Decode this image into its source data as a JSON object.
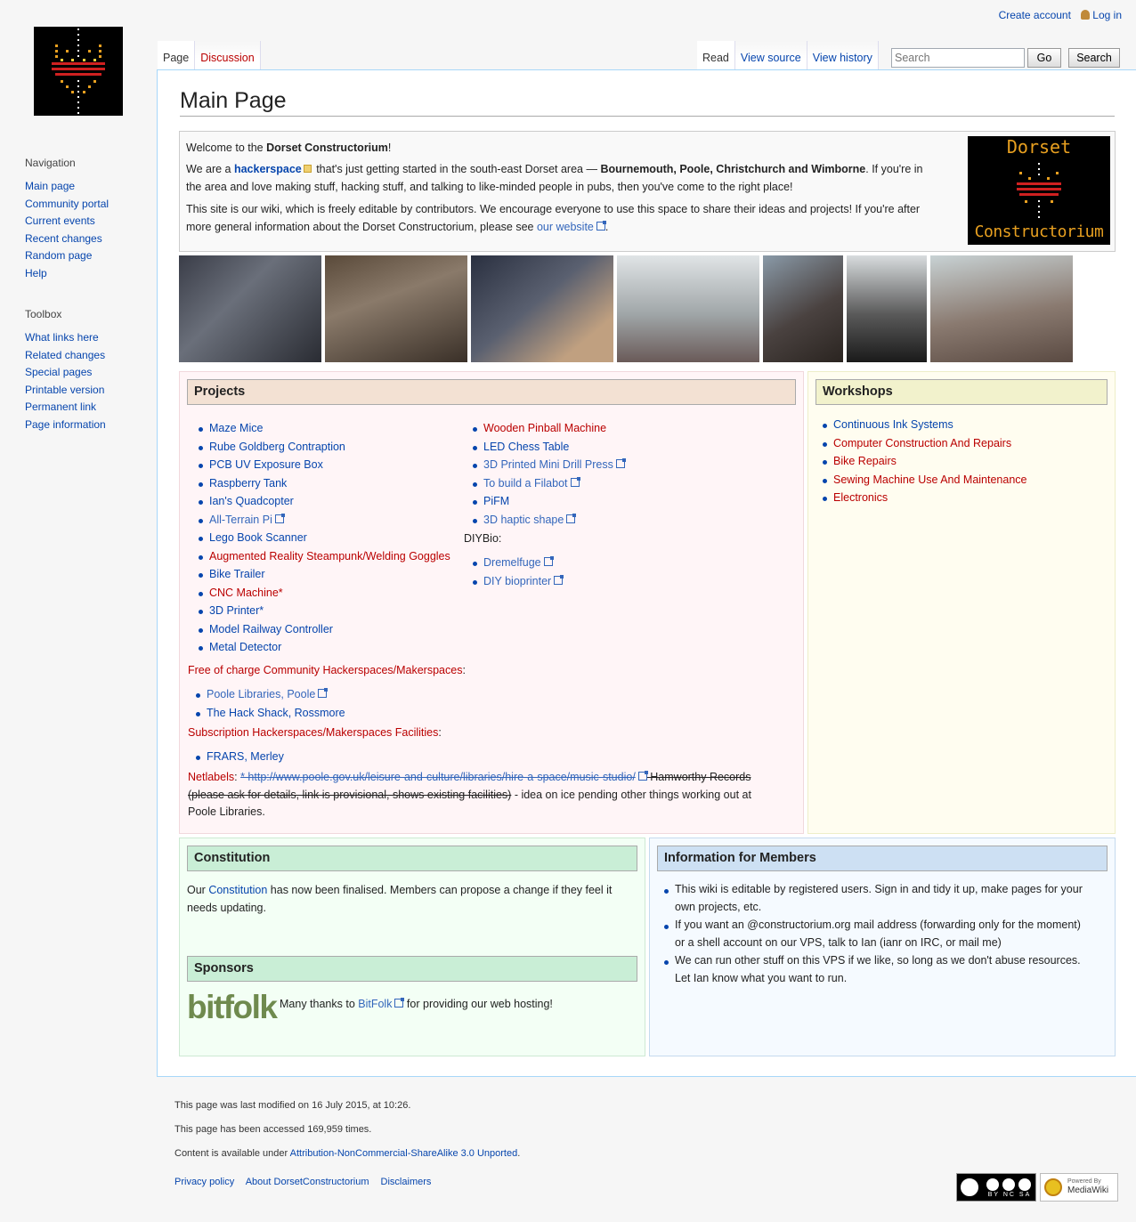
{
  "personal": {
    "create_account": "Create account",
    "log_in": "Log in"
  },
  "tabs": {
    "page": "Page",
    "discussion": "Discussion",
    "read": "Read",
    "view_source": "View source",
    "view_history": "View history"
  },
  "search": {
    "placeholder": "Search",
    "go": "Go",
    "search": "Search"
  },
  "sidebar": {
    "navigation_title": "Navigation",
    "navigation": [
      "Main page",
      "Community portal",
      "Current events",
      "Recent changes",
      "Random page",
      "Help"
    ],
    "toolbox_title": "Toolbox",
    "toolbox": [
      "What links here",
      "Related changes",
      "Special pages",
      "Printable version",
      "Permanent link",
      "Page information"
    ]
  },
  "page_title": "Main Page",
  "welcome": {
    "line1_pre": "Welcome to the ",
    "line1_bold": "Dorset Constructorium",
    "line1_post": "!",
    "p2_pre": "We are a ",
    "p2_link": "hackerspace",
    "p2_mid": " that's just getting started in the south-east Dorset area — ",
    "p2_bold": "Bournemouth, Poole, Christchurch and Wimborne",
    "p2_post": ". If you're in",
    "p2_line2": "the area and love making stuff, hacking stuff, and talking to like-minded people in pubs, then you've come to the right place!",
    "p3_line1": "This site is our wiki, which is freely editable by contributors. We encourage everyone to use this space to share their ideas and projects! If you're after",
    "p3_line2_pre": "more general information about the Dorset Constructorium, please see ",
    "p3_link": "our website",
    "p3_post": ".",
    "logo_top": "Dorset",
    "logo_bottom": "Constructorium"
  },
  "projects": {
    "title": "Projects",
    "col1": [
      "Maze Mice",
      "Rube Goldberg Contraption",
      "PCB UV Exposure Box",
      "Raspberry Tank",
      "Ian's Quadcopter",
      "All-Terrain Pi",
      "Lego Book Scanner",
      "Augmented Reality Steampunk/Welding Goggles",
      "Bike Trailer",
      "CNC Machine*",
      "3D Printer*",
      "Model Railway Controller",
      "Metal Detector"
    ],
    "col2": [
      "Wooden Pinball Machine",
      "LED Chess Table",
      "3D Printed Mini Drill Press",
      "To build a Filabot",
      "PiFM",
      "3D haptic shape"
    ],
    "diybio_label": "DIYBio",
    "diybio": [
      "Dremelfuge",
      "DIY bioprinter"
    ],
    "free_label": "Free of charge Community Hackerspaces/Makerspaces",
    "free": [
      "Poole Libraries, Poole",
      "The Hack Shack, Rossmore"
    ],
    "sub_label": "Subscription Hackerspaces/Makerspaces Facilities",
    "sub": [
      "FRARS, Merley"
    ],
    "netlabels_label": "Netlabels",
    "netlabels_link": "* http://www.poole.gov.uk/leisure-and-culture/libraries/hire-a-space/music-studio/",
    "netlabels_strike1": " Hamworthy Records",
    "netlabels_strike2": "(please ask for details, link is provisional, shows existing facilities)",
    "netlabels_post": " - idea on ice pending other things working out at",
    "netlabels_line3": "Poole Libraries."
  },
  "workshops": {
    "title": "Workshops",
    "items": [
      "Continuous Ink Systems",
      "Computer Construction And Repairs",
      "Bike Repairs",
      "Sewing Machine Use And Maintenance",
      "Electronics"
    ]
  },
  "constitution": {
    "title": "Constitution",
    "pre": "Our ",
    "link": "Constitution",
    "post": " has now been finalised. Members can propose a change if they feel it",
    "line2": "needs updating."
  },
  "sponsors": {
    "title": "Sponsors",
    "logo": "bitfolk",
    "pre": "Many thanks to ",
    "link": "BitFolk",
    "post": " for providing our web hosting!"
  },
  "members": {
    "title": "Information for Members",
    "items": [
      [
        "This wiki is editable by registered users. Sign in and tidy it up, make pages for your",
        "own projects, etc."
      ],
      [
        "If you want an @constructorium.org mail address (forwarding only for the moment)",
        "or a shell account on our VPS, talk to Ian (ianr on IRC, or mail me)"
      ],
      [
        "We can run other stuff on this VPS if we like, so long as we don't abuse resources.",
        "Let Ian know what you want to run."
      ]
    ]
  },
  "footer": {
    "modified": "This page was last modified on 16 July 2015, at 10:26.",
    "accessed": "This page has been accessed 169,959 times.",
    "license_pre": "Content is available under ",
    "license_link": "Attribution-NonCommercial-ShareAlike 3.0 Unported",
    "license_post": ".",
    "links": [
      "Privacy policy",
      "About DorsetConstructorium",
      "Disclaimers"
    ],
    "cc_badge": "BY NC SA",
    "mw_badge_top": "Powered By",
    "mw_badge": "MediaWiki"
  }
}
